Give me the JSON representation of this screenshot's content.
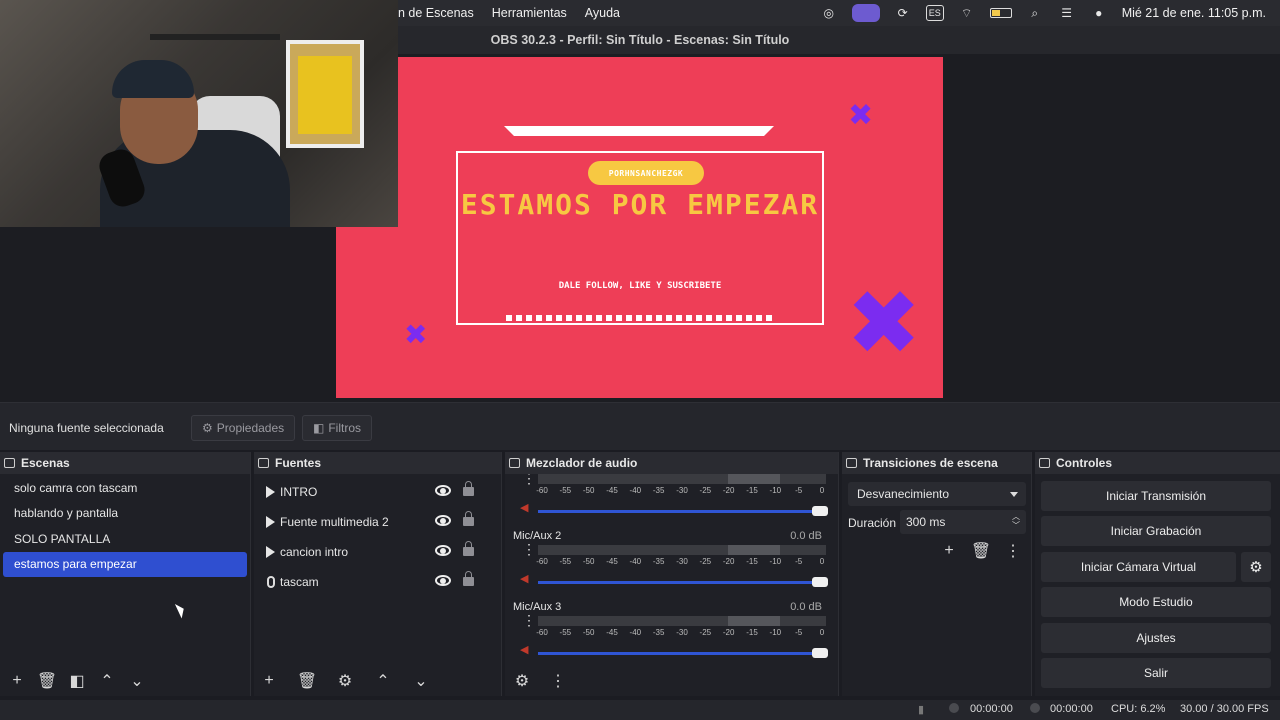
{
  "menubar": {
    "menus": [
      "n de Escenas",
      "Herramientas",
      "Ayuda"
    ],
    "status_input_badge": "ES",
    "clock": "Mié 21 de ene.  11:05 p.m."
  },
  "window": {
    "title": "OBS 30.2.3 - Perfil: Sin Título - Escenas: Sin Título"
  },
  "preview": {
    "tag": "PORHNSANCHEZGK",
    "headline": "ESTAMOS POR EMPEZAR",
    "subline": "DALE FOLLOW, LIKE Y SUSCRIBETE",
    "accent_color": "#ee3e57",
    "mark_color": "#7b2cf0",
    "text_color": "#f7c842"
  },
  "propbar": {
    "none_selected": "Ninguna fuente seleccionada",
    "properties": "Propiedades",
    "filters": "Filtros"
  },
  "scenes": {
    "title": "Escenas",
    "items": [
      "solo camra con tascam",
      "hablando y pantalla",
      "SOLO PANTALLA",
      "estamos para empezar"
    ],
    "selected": "estamos para empezar"
  },
  "sources": {
    "title": "Fuentes",
    "items": [
      {
        "label": "INTRO",
        "icon": "play-icon"
      },
      {
        "label": "Fuente multimedia 2",
        "icon": "play-icon"
      },
      {
        "label": "cancion intro",
        "icon": "play-icon"
      },
      {
        "label": "tascam",
        "icon": "mic-icon"
      }
    ]
  },
  "mixer": {
    "title": "Mezclador de audio",
    "scale": [
      "-60",
      "-55",
      "-50",
      "-45",
      "-40",
      "-35",
      "-30",
      "-25",
      "-20",
      "-15",
      "-10",
      "-5",
      "0"
    ],
    "channels": [
      {
        "name": "",
        "db": ""
      },
      {
        "name": "Mic/Aux 2",
        "db": "0.0 dB"
      },
      {
        "name": "Mic/Aux 3",
        "db": "0.0 dB"
      }
    ]
  },
  "transitions": {
    "title": "Transiciones de escena",
    "selected": "Desvanecimiento",
    "duration_label": "Duración",
    "duration": "300 ms"
  },
  "controls": {
    "title": "Controles",
    "start_stream": "Iniciar Transmisión",
    "start_record": "Iniciar Grabación",
    "start_virtualcam": "Iniciar Cámara Virtual",
    "studio_mode": "Modo Estudio",
    "settings": "Ajustes",
    "exit": "Salir"
  },
  "statusbar": {
    "stream_time": "00:00:00",
    "record_time": "00:00:00",
    "cpu": "CPU: 6.2%",
    "fps": "30.00 / 30.00 FPS"
  }
}
